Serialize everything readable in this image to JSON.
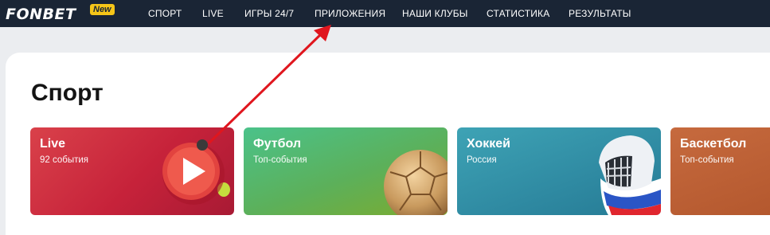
{
  "brand": {
    "logo_text": "FONBET",
    "badge": "New"
  },
  "nav": {
    "items": [
      {
        "label": "СПОРТ"
      },
      {
        "label": "LIVE"
      },
      {
        "label": "ИГРЫ 24/7"
      },
      {
        "label": "ПРИЛОЖЕНИЯ"
      },
      {
        "label": "НАШИ КЛУБЫ"
      },
      {
        "label": "СТАТИСТИКА"
      },
      {
        "label": "РЕЗУЛЬТАТЫ"
      }
    ]
  },
  "main": {
    "title": "Спорт",
    "cards": [
      {
        "title": "Live",
        "subtitle": "92 события",
        "icon": "play-button-icon"
      },
      {
        "title": "Футбол",
        "subtitle": "Топ-события",
        "icon": "soccer-ball-icon"
      },
      {
        "title": "Хоккей",
        "subtitle": "Россия",
        "icon": "hockey-helmet-icon"
      },
      {
        "title": "Баскетбол",
        "subtitle": "Топ-события",
        "icon": "basketball-icon"
      }
    ]
  },
  "annotation": {
    "color": "#e0161e",
    "icon": "red-arrow-icon"
  },
  "colors": {
    "nav_bg": "#1a2535",
    "badge": "#f5c518",
    "live": "#c6223a",
    "football": "#5cb05a",
    "hockey": "#2f8aa2",
    "basketball": "#b4582e"
  }
}
